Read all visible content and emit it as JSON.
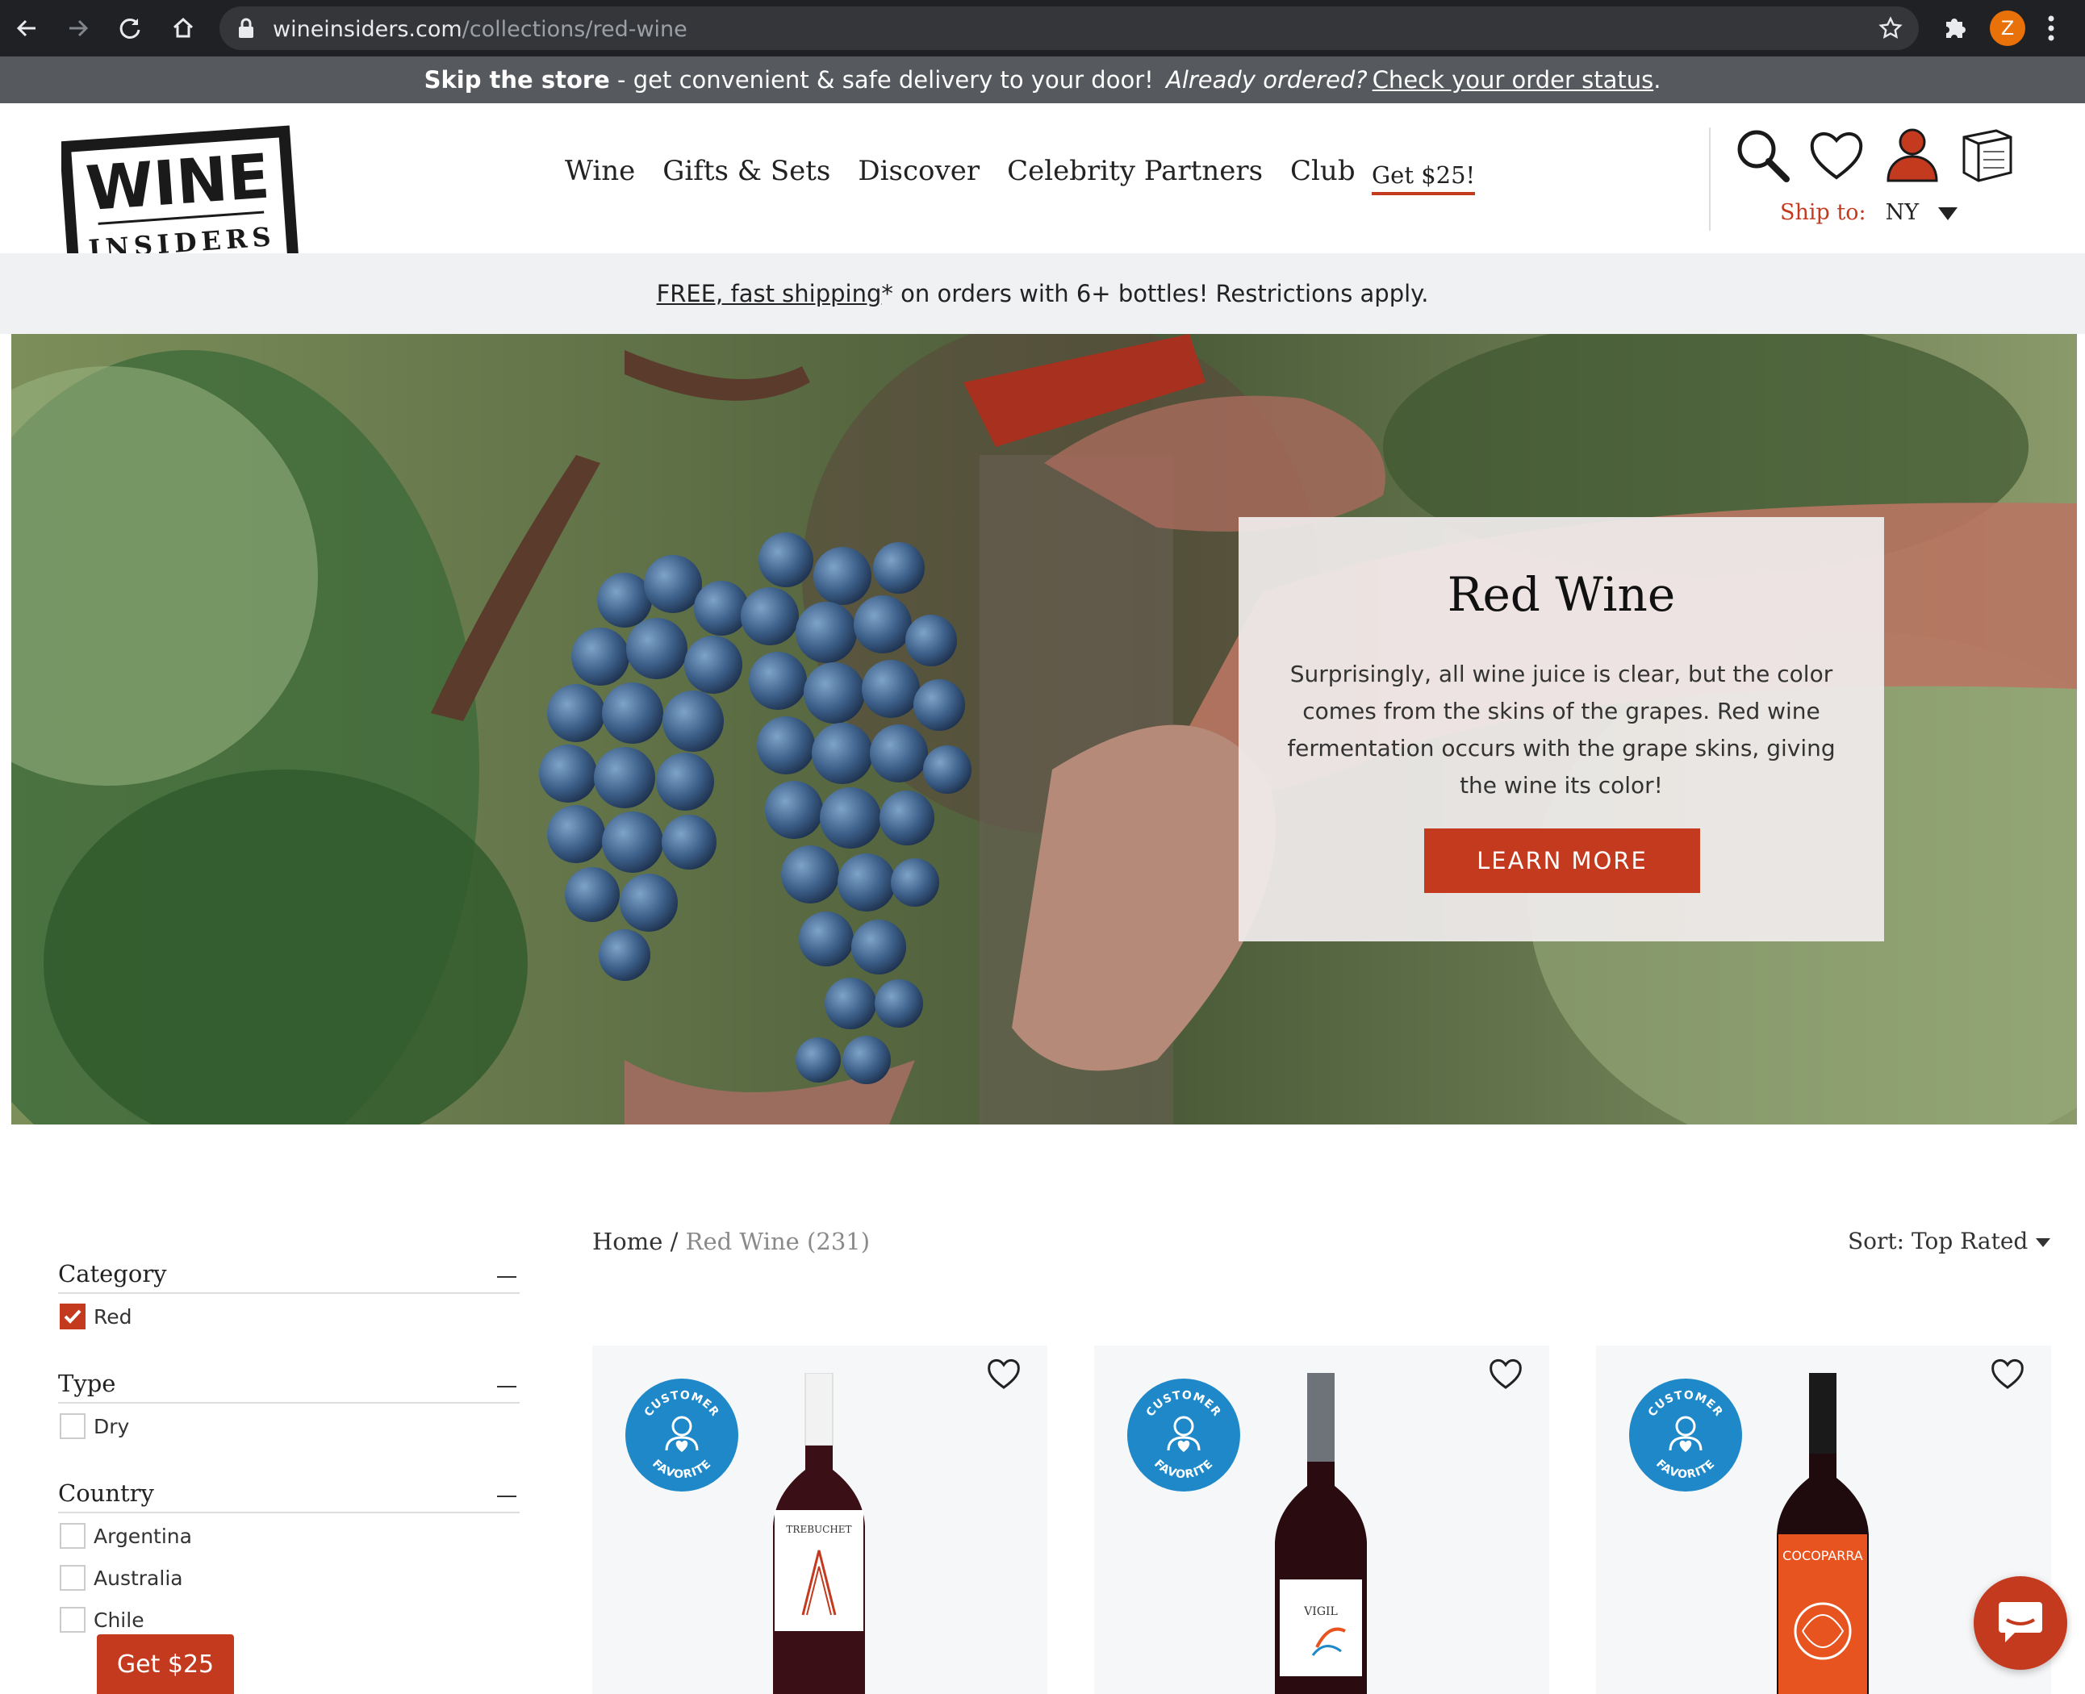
{
  "browser": {
    "url_domain": "wineinsiders.com",
    "url_path": "/collections/red-wine",
    "profile_initial": "Z"
  },
  "promo": {
    "bold": "Skip the store",
    "text": " - get convenient & safe delivery to your door! ",
    "italic": "Already ordered?",
    "link": "Check your order status",
    "trailing": "."
  },
  "logo": {
    "line1": "WINE",
    "line2": "INSIDERS",
    "mark": "®"
  },
  "nav": {
    "items": [
      "Wine",
      "Gifts & Sets",
      "Discover",
      "Celebrity Partners",
      "Club"
    ],
    "get_offer": "Get $25!"
  },
  "header_icons": [
    "search-icon",
    "heart-icon",
    "account-icon",
    "cart-icon"
  ],
  "ship": {
    "label": "Ship to:",
    "state": "NY"
  },
  "shipping_notice": {
    "link": "FREE, fast shipping",
    "text": "* on orders with 6+ bottles! Restrictions apply."
  },
  "hero": {
    "title": "Red Wine",
    "body": "Surprisingly, all wine juice is clear, but the color comes from the skins of the grapes. Red wine fermentation occurs with the grape skins, giving the wine its color!",
    "button": "LEARN MORE"
  },
  "filters": [
    {
      "title": "Category",
      "options": [
        {
          "label": "Red",
          "checked": true
        }
      ]
    },
    {
      "title": "Type",
      "options": [
        {
          "label": "Dry",
          "checked": false
        }
      ]
    },
    {
      "title": "Country",
      "options": [
        {
          "label": "Argentina",
          "checked": false
        },
        {
          "label": "Australia",
          "checked": false
        },
        {
          "label": "Chile",
          "checked": false
        }
      ]
    }
  ],
  "breadcrumb": {
    "home": "Home",
    "separator": " / ",
    "current": "Red Wine (231)"
  },
  "sort": {
    "label": "Sort: Top Rated"
  },
  "badge": {
    "top": "CUSTOMER",
    "bottom": "FAVORITE"
  },
  "products": [
    {
      "label_text": "TREBUCHET",
      "label_color": "#ffffff",
      "capsule": "#f2f2f2"
    },
    {
      "label_text": "VIGIL",
      "label_color": "#ffffff",
      "capsule": "#6d7378"
    },
    {
      "label_text": "COCOPARRA",
      "label_color": "#e8541f",
      "capsule": "#1a1a1a"
    }
  ],
  "floating": {
    "get_button": "Get $25"
  },
  "colors": {
    "accent": "#c43a1f",
    "badge_blue": "#1e88c9",
    "promo_bar": "#56595e"
  }
}
